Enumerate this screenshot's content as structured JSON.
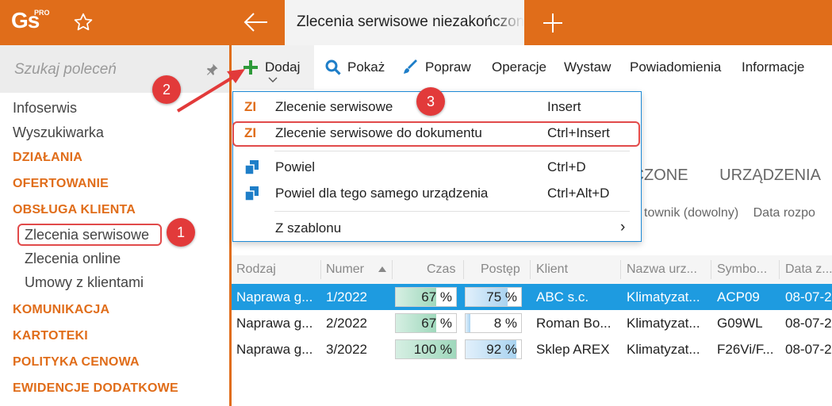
{
  "app": {
    "logo_text": "Gs",
    "logo_sup": "PRO",
    "active_tab_title": "Zlecenia serwisowe niezakończone"
  },
  "sidebar": {
    "search_placeholder": "Szukaj poleceń",
    "items": [
      {
        "label": "Infoserwis",
        "kind": "item"
      },
      {
        "label": "Wyszukiwarka",
        "kind": "item"
      },
      {
        "label": "DZIAŁANIA",
        "kind": "section"
      },
      {
        "label": "OFERTOWANIE",
        "kind": "section"
      },
      {
        "label": "OBSŁUGA KLIENTA",
        "kind": "section"
      },
      {
        "label": "Zlecenia serwisowe",
        "kind": "subitem",
        "active": true
      },
      {
        "label": "Zlecenia online",
        "kind": "subitem"
      },
      {
        "label": "Umowy z klientami",
        "kind": "subitem"
      },
      {
        "label": "KOMUNIKACJA",
        "kind": "section"
      },
      {
        "label": "KARTOTEKI",
        "kind": "section"
      },
      {
        "label": "POLITYKA CENOWA",
        "kind": "section"
      },
      {
        "label": "EWIDENCJE DODATKOWE",
        "kind": "section"
      }
    ]
  },
  "toolbar": {
    "dodaj": "Dodaj",
    "pokaz": "Pokaż",
    "popraw": "Popraw",
    "operacje": "Operacje",
    "wystaw": "Wystaw",
    "powiadomienia": "Powiadomienia",
    "informacje": "Informacje"
  },
  "dropdown": {
    "items": [
      {
        "icon_text": "ZI",
        "label": "Zlecenie serwisowe",
        "shortcut": "Insert",
        "icon": "zi-icon"
      },
      {
        "icon_text": "ZI",
        "label": "Zlecenie serwisowe do dokumentu",
        "shortcut": "Ctrl+Insert",
        "icon": "zi-icon"
      },
      {
        "icon_text": "",
        "label": "Powiel",
        "shortcut": "Ctrl+D",
        "icon": "copy-icon"
      },
      {
        "icon_text": "",
        "label": "Powiel dla tego samego urządzenia",
        "shortcut": "Ctrl+Alt+D",
        "icon": "copy-icon"
      },
      {
        "icon_text": "",
        "label": "Z szablonu",
        "shortcut": "›",
        "icon": "submenu-chevron"
      }
    ]
  },
  "content": {
    "tab_partial_1": "ICZONE",
    "tab_2": "URZĄDZENIA",
    "filter_1": "townik (dowolny)",
    "filter_2": "Data rozpo"
  },
  "table": {
    "columns": [
      "Rodzaj",
      "Numer",
      "Czas",
      "Postęp",
      "Klient",
      "Nazwa urz...",
      "Symbo...",
      "Data z..."
    ],
    "rows": [
      {
        "rodzaj": "Naprawa g...",
        "numer": "1/2022",
        "czas": "67 %",
        "czas_value": 67,
        "postep": "75 %",
        "postep_value": 75,
        "klient": "ABC s.c.",
        "nazwa": "Klimatyzat...",
        "symbol": "ACP09",
        "data": "08-07-2",
        "selected": true
      },
      {
        "rodzaj": "Naprawa g...",
        "numer": "2/2022",
        "czas": "67 %",
        "czas_value": 67,
        "postep": "8 %",
        "postep_value": 8,
        "klient": "Roman Bo...",
        "nazwa": "Klimatyzat...",
        "symbol": "G09WL",
        "data": "08-07-2",
        "selected": false
      },
      {
        "rodzaj": "Naprawa g...",
        "numer": "3/2022",
        "czas": "100 %",
        "czas_value": 100,
        "postep": "92 %",
        "postep_value": 92,
        "klient": "Sklep AREX",
        "nazwa": "Klimatyzat...",
        "symbol": "F26Vi/F...",
        "data": "08-07-2",
        "selected": false
      }
    ]
  },
  "annotations": {
    "badge_1": "1",
    "badge_2": "2",
    "badge_3": "3"
  },
  "colors": {
    "accent": "#e06d1a",
    "selection": "#1e9be0",
    "marker": "#e23a3a"
  }
}
